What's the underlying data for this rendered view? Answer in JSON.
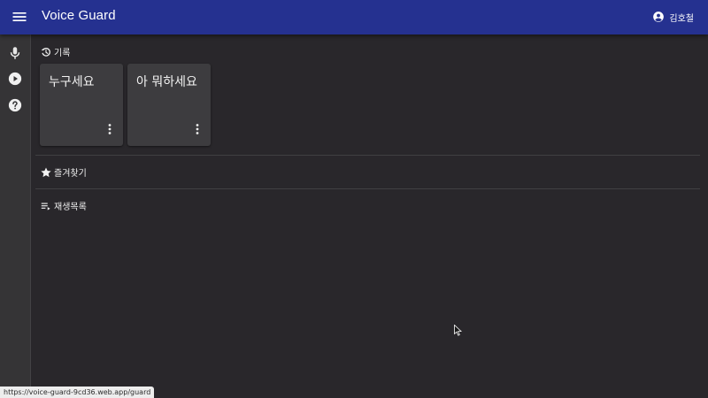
{
  "app": {
    "title": "Voice Guard"
  },
  "header": {
    "menu_icon": "menu-icon",
    "account_icon": "account-circle-icon",
    "user_name": "김호철"
  },
  "nav_rail": [
    {
      "icon": "microphone-icon"
    },
    {
      "icon": "play-circle-icon"
    },
    {
      "icon": "help-circle-icon"
    }
  ],
  "sections": {
    "history": {
      "icon": "history-icon",
      "label": "기록",
      "cards": [
        {
          "title": "누구세요",
          "menu_icon": "more-vert-icon"
        },
        {
          "title": "아 뭐하세요",
          "menu_icon": "more-vert-icon"
        }
      ]
    },
    "favorites": {
      "icon": "star-icon",
      "label": "즐겨찾기"
    },
    "playlist": {
      "icon": "playlist-icon",
      "label": "재생목록"
    }
  },
  "status_url": "https://voice-guard-9cd36.web.app/guard",
  "colors": {
    "appbar": "#253190",
    "background": "#29272b",
    "rail": "#353436",
    "card": "#3d3c3f",
    "text": "#e8e8e8"
  }
}
